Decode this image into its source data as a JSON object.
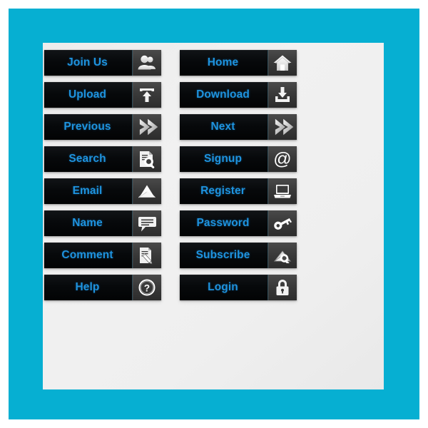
{
  "frame": {
    "outer_background": "#ffffff",
    "border_color": "#06AFD2",
    "panel_color": "#ededed"
  },
  "style": {
    "button_background": "#07090b",
    "label_color": "#1E93DF",
    "icon_panel_color": "#3b3b3b",
    "icon_color": "#ffffff"
  },
  "buttons": {
    "left_column": [
      {
        "label": "Join Us",
        "icon": "users-icon"
      },
      {
        "label": "Upload",
        "icon": "upload-icon"
      },
      {
        "label": "Previous",
        "icon": "arrow-right-icon"
      },
      {
        "label": "Search",
        "icon": "search-document-icon"
      },
      {
        "label": "Email",
        "icon": "envelope-icon"
      },
      {
        "label": "Name",
        "icon": "speech-bubble-icon"
      },
      {
        "label": "Comment",
        "icon": "write-document-icon"
      },
      {
        "label": "Help",
        "icon": "question-mark-icon"
      }
    ],
    "right_column": [
      {
        "label": "Home",
        "icon": "house-icon"
      },
      {
        "label": "Download",
        "icon": "download-icon"
      },
      {
        "label": "Next",
        "icon": "arrow-right-icon"
      },
      {
        "label": "Signup",
        "icon": "at-sign-icon"
      },
      {
        "label": "Register",
        "icon": "laptop-icon"
      },
      {
        "label": "Password",
        "icon": "key-icon"
      },
      {
        "label": "Subscribe",
        "icon": "envelope-search-icon"
      },
      {
        "label": "Login",
        "icon": "lock-icon"
      }
    ]
  }
}
